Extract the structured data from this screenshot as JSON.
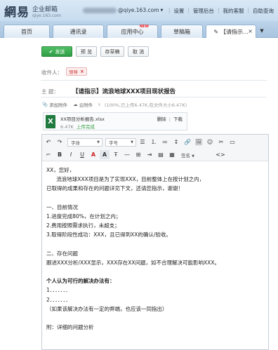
{
  "header": {
    "logo_big": "網易",
    "logo_cn": "企业邮箱",
    "logo_domain": "qiye.163.com",
    "account_suffix": "@qiye.163.com",
    "account_arrow": "▼",
    "links": [
      "设置",
      "管理后台",
      "我的客服",
      "自助查询"
    ]
  },
  "tabs": {
    "home": "首页",
    "contacts": "通讯录",
    "apps": "应用中心",
    "apps_badge": "NEW",
    "drafts": "草稿箱",
    "compose": "【请指示...",
    "compose_close": "×",
    "dropdown": "▼"
  },
  "actions": {
    "send": "发送",
    "preview": "预 览",
    "save_draft": "存草稿",
    "cancel": "取 消"
  },
  "compose": {
    "to_label": "收件人：",
    "recipient": "领导",
    "recipient_remove": "×",
    "subject_label": "主    题：",
    "subject": "【请指示】流浪地球XXX项目现状报告"
  },
  "attachments": {
    "add_label": "添加附件",
    "cloud_label": "云附件",
    "info": "(100%,已上传6.47K,包文件大小6.47K)",
    "file_name": "XX项目分析报告.xlsx",
    "file_size": "6.47K",
    "file_status": "上传完成",
    "delete_label": "删除",
    "download_label": "下载",
    "actions_sep": "|"
  },
  "editor": {
    "font_placeholder": "字体",
    "size_placeholder": "字号",
    "signature_label": "签名"
  },
  "body": [
    "XX，您好，",
    "      流浪地球XXX项目是为了实现XXX，目前整体上在按计划之内，",
    "已取得的成果和存在的问题详见下文，还请您指示，谢谢！",
    "",
    "一、目前情况",
    "1.进度完成80%，在计划之内；",
    "2.费用按照需求执行，未超支；",
    "3.取得阶段性成功：XXX，且已得到XX的确认/验收。",
    "",
    "二、存在问题",
    "跟进XXX分析/XXX显示，XXX存在XX问题，如不合理解决可能影响XXX。",
    "",
    "个人认为可行的解决办法有：",
    "1．．．．．．．",
    "2．．．．．．．",
    "（如果该解决办法有一定的弊端，也应该一同指出）",
    "",
    "附：详细的问题分析"
  ],
  "colors": {
    "send_button": "#3aa84f",
    "recipient_chip": "#c33333",
    "upload_done": "#3aa04a",
    "excel": "#1f7a3f"
  }
}
